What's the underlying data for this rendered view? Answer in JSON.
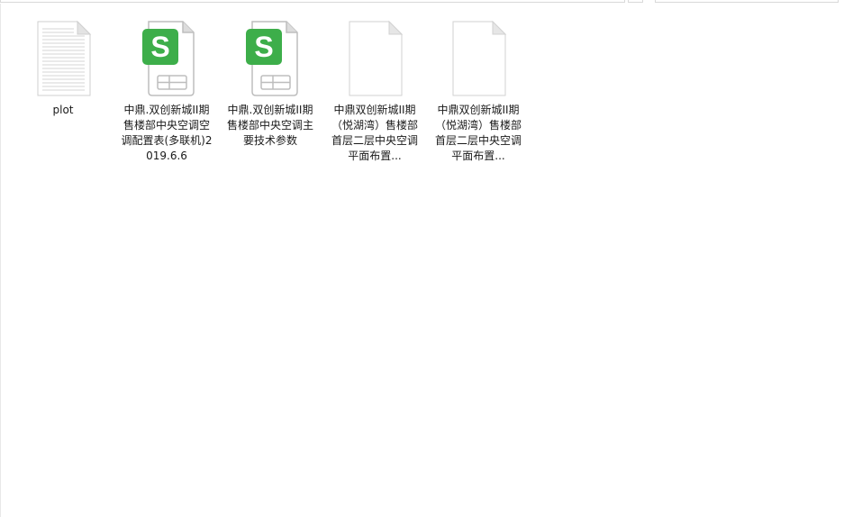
{
  "files": [
    {
      "name": "plot",
      "icon": "text-document-icon"
    },
    {
      "name": "中鼎.双创新城II期售楼部中央空调空调配置表(多联机)2019.6.6",
      "icon": "wps-spreadsheet-icon"
    },
    {
      "name": "中鼎.双创新城II期售楼部中央空调主要技术参数",
      "icon": "wps-spreadsheet-icon"
    },
    {
      "name": "中鼎双创新城II期（悦湖湾）售楼部 首层二层中央空调平面布置...",
      "icon": "blank-document-icon"
    },
    {
      "name": "中鼎双创新城II期（悦湖湾）售楼部 首层二层中央空调平面布置...",
      "icon": "blank-document-icon"
    }
  ],
  "colors": {
    "wps_green": "#3dae4a",
    "page_fold": "#d9d9d9",
    "doc_border": "#d2d2d2"
  }
}
